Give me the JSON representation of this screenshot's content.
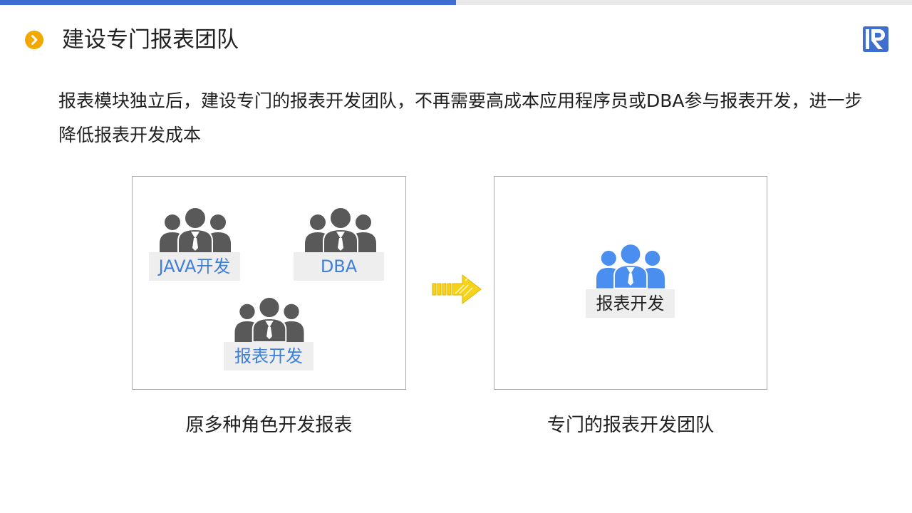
{
  "progress_fraction": 0.5,
  "header": {
    "title": "建设专门报表团队",
    "bullet_icon": "chevron-right-circle-icon",
    "logo_icon": "runqian-r-logo"
  },
  "body": {
    "paragraph": "报表模块独立后，建设专门的报表开发团队，不再需要高成本应用程序员或DBA参与报表开发，进一步降低报表开发成本"
  },
  "left_panel": {
    "groups": [
      {
        "label": "JAVA开发",
        "icon": "people-group-icon"
      },
      {
        "label": "DBA",
        "icon": "people-group-icon"
      },
      {
        "label": "报表开发",
        "icon": "people-group-icon"
      }
    ],
    "caption": "原多种角色开发报表"
  },
  "right_panel": {
    "group": {
      "label": "报表开发",
      "icon": "people-group-icon"
    },
    "caption": "专门的报表开发团队"
  },
  "colors": {
    "accent_blue": "#3f6fce",
    "bullet_orange": "#f2a800",
    "icon_gray": "#595959",
    "icon_blue": "#4a8ff0",
    "label_blue": "#3f7fd8",
    "arrow_yellow": "#f5d21c"
  }
}
